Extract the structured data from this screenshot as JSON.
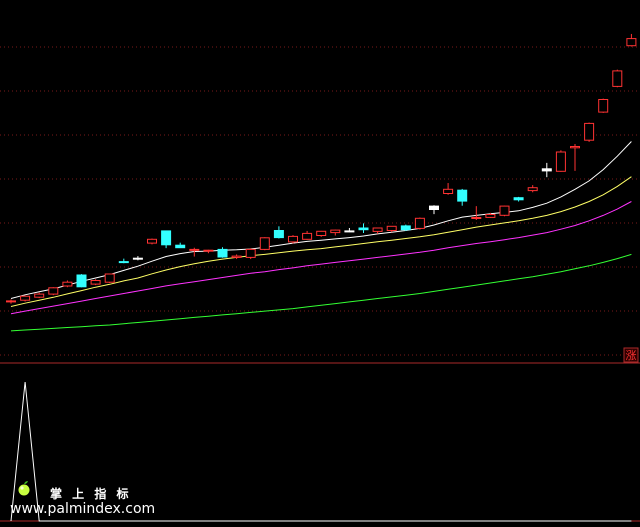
{
  "chart_data": {
    "type": "candlestick",
    "panels": [
      {
        "name": "price",
        "candles": [
          {
            "o": 61.0,
            "h": 62.2,
            "l": 60.2,
            "c": 61.5,
            "color": "red"
          },
          {
            "o": 61.8,
            "h": 64.0,
            "l": 61.2,
            "c": 63.7,
            "color": "red"
          },
          {
            "o": 63.2,
            "h": 65.4,
            "l": 62.8,
            "c": 64.7,
            "color": "red"
          },
          {
            "o": 64.7,
            "h": 68.0,
            "l": 64.2,
            "c": 67.7,
            "color": "red"
          },
          {
            "o": 68.6,
            "h": 71.2,
            "l": 68.0,
            "c": 70.4,
            "color": "red"
          },
          {
            "o": 73.8,
            "h": 74.2,
            "l": 68.0,
            "c": 68.2,
            "color": "cyan"
          },
          {
            "o": 69.5,
            "h": 71.8,
            "l": 69.0,
            "c": 71.2,
            "color": "red"
          },
          {
            "o": 70.4,
            "h": 74.5,
            "l": 70.0,
            "c": 74.3,
            "color": "red"
          },
          {
            "o": 80.2,
            "h": 81.6,
            "l": 79.4,
            "c": 79.8,
            "color": "cyan"
          },
          {
            "o": 81.8,
            "h": 82.8,
            "l": 80.8,
            "c": 81.5,
            "color": "white"
          },
          {
            "o": 89.0,
            "h": 91.2,
            "l": 88.4,
            "c": 90.8,
            "color": "red"
          },
          {
            "o": 94.8,
            "h": 95.0,
            "l": 86.6,
            "c": 88.2,
            "color": "cyan"
          },
          {
            "o": 88.0,
            "h": 89.2,
            "l": 86.8,
            "c": 86.8,
            "color": "cyan"
          },
          {
            "o": 85.6,
            "h": 86.8,
            "l": 82.6,
            "c": 86.0,
            "color": "red"
          },
          {
            "o": 85.2,
            "h": 85.8,
            "l": 84.2,
            "c": 85.6,
            "color": "red"
          },
          {
            "o": 86.0,
            "h": 87.0,
            "l": 82.0,
            "c": 82.4,
            "color": "cyan"
          },
          {
            "o": 82.2,
            "h": 83.6,
            "l": 81.4,
            "c": 82.8,
            "color": "red"
          },
          {
            "o": 82.2,
            "h": 86.6,
            "l": 81.4,
            "c": 86.0,
            "color": "red"
          },
          {
            "o": 86.0,
            "h": 91.8,
            "l": 85.6,
            "c": 91.5,
            "color": "red"
          },
          {
            "o": 95.0,
            "h": 97.0,
            "l": 91.2,
            "c": 91.6,
            "color": "cyan"
          },
          {
            "o": 89.6,
            "h": 92.8,
            "l": 88.8,
            "c": 92.2,
            "color": "red"
          },
          {
            "o": 90.8,
            "h": 94.8,
            "l": 90.6,
            "c": 93.6,
            "color": "red"
          },
          {
            "o": 92.6,
            "h": 94.8,
            "l": 92.0,
            "c": 94.6,
            "color": "red"
          },
          {
            "o": 94.0,
            "h": 95.4,
            "l": 92.6,
            "c": 95.2,
            "color": "red"
          },
          {
            "o": 94.6,
            "h": 96.2,
            "l": 94.2,
            "c": 94.8,
            "color": "white"
          },
          {
            "o": 95.4,
            "h": 98.4,
            "l": 93.8,
            "c": 96.2,
            "color": "cyan"
          },
          {
            "o": 94.6,
            "h": 96.2,
            "l": 93.4,
            "c": 96.2,
            "color": "red"
          },
          {
            "o": 95.0,
            "h": 97.0,
            "l": 94.2,
            "c": 97.0,
            "color": "red"
          },
          {
            "o": 97.2,
            "h": 97.8,
            "l": 94.8,
            "c": 95.4,
            "color": "cyan"
          },
          {
            "o": 96.0,
            "h": 101.2,
            "l": 95.4,
            "c": 100.8,
            "color": "red"
          },
          {
            "o": 106.6,
            "h": 107.0,
            "l": 102.8,
            "c": 105.0,
            "color": "white"
          },
          {
            "o": 112.6,
            "h": 117.6,
            "l": 112.0,
            "c": 114.6,
            "color": "red"
          },
          {
            "o": 114.2,
            "h": 114.8,
            "l": 106.8,
            "c": 109.0,
            "color": "cyan"
          },
          {
            "o": 100.8,
            "h": 106.6,
            "l": 100.0,
            "c": 101.2,
            "color": "red"
          },
          {
            "o": 101.2,
            "h": 103.4,
            "l": 101.0,
            "c": 102.6,
            "color": "red"
          },
          {
            "o": 102.2,
            "h": 106.8,
            "l": 101.8,
            "c": 106.6,
            "color": "red"
          },
          {
            "o": 110.6,
            "h": 111.0,
            "l": 108.8,
            "c": 109.6,
            "color": "cyan"
          },
          {
            "o": 114.0,
            "h": 116.6,
            "l": 113.2,
            "c": 115.4,
            "color": "red"
          },
          {
            "o": 123.4,
            "h": 127.2,
            "l": 120.4,
            "c": 124.4,
            "color": "white"
          },
          {
            "o": 123.2,
            "h": 133.2,
            "l": 123.0,
            "c": 132.4,
            "color": "red"
          },
          {
            "o": 134.4,
            "h": 136.2,
            "l": 123.4,
            "c": 135.0,
            "color": "red"
          },
          {
            "o": 138.0,
            "h": 146.4,
            "l": 137.2,
            "c": 146.0,
            "color": "red"
          },
          {
            "o": 151.4,
            "h": 157.8,
            "l": 151.0,
            "c": 157.4,
            "color": "red"
          },
          {
            "o": 163.6,
            "h": 171.6,
            "l": 163.2,
            "c": 171.0,
            "color": "red"
          },
          {
            "o": 183.0,
            "h": 188.6,
            "l": 182.6,
            "c": 186.4,
            "color": "red"
          }
        ],
        "lines": [
          {
            "color": "#ffffff",
            "values": [
              62.6,
              64.4,
              65.8,
              67.2,
              69.0,
              70.8,
              72.4,
              74.0,
              76.0,
              78.0,
              80.4,
              82.6,
              84.0,
              85.0,
              85.2,
              85.6,
              85.8,
              86.2,
              87.0,
              88.0,
              89.0,
              89.8,
              90.4,
              91.0,
              91.6,
              92.4,
              93.4,
              94.2,
              95.0,
              96.0,
              97.6,
              99.6,
              101.4,
              102.2,
              103.0,
              103.6,
              104.4,
              106.0,
              108.0,
              111.0,
              114.6,
              118.6,
              124.0,
              130.4,
              137.4
            ]
          },
          {
            "color": "#ffff66",
            "values": [
              58.8,
              60.4,
              61.8,
              63.2,
              64.8,
              66.4,
              68.0,
              69.4,
              71.0,
              72.4,
              74.4,
              76.2,
              77.8,
              79.2,
              80.4,
              81.4,
              82.2,
              83.0,
              83.6,
              84.4,
              85.2,
              85.8,
              86.4,
              87.2,
              88.0,
              88.8,
              89.6,
              90.4,
              91.2,
              92.0,
              93.0,
              94.2,
              95.4,
              96.6,
              97.6,
              98.6,
              99.6,
              100.8,
              102.2,
              104.0,
              106.2,
              108.8,
              112.0,
              116.0,
              120.6
            ]
          },
          {
            "color": "#ff33ff",
            "values": [
              55.4,
              56.6,
              57.8,
              59.0,
              60.2,
              61.4,
              62.6,
              63.8,
              65.0,
              66.2,
              67.4,
              68.6,
              69.6,
              70.6,
              71.6,
              72.6,
              73.6,
              74.6,
              75.4,
              76.4,
              77.2,
              78.2,
              79.0,
              79.8,
              80.6,
              81.4,
              82.2,
              83.0,
              83.8,
              84.6,
              85.6,
              86.8,
              87.8,
              88.8,
              89.6,
              90.6,
              91.6,
              92.8,
              94.0,
              95.6,
              97.4,
              99.6,
              102.2,
              105.2,
              108.8
            ]
          },
          {
            "color": "#33ff33",
            "values": [
              47.2,
              47.6,
              48.0,
              48.4,
              48.8,
              49.2,
              49.6,
              50.0,
              50.6,
              51.2,
              51.8,
              52.4,
              53.0,
              53.6,
              54.2,
              54.8,
              55.4,
              56.0,
              56.6,
              57.2,
              57.8,
              58.6,
              59.4,
              60.2,
              61.0,
              61.8,
              62.6,
              63.4,
              64.2,
              65.0,
              66.0,
              67.0,
              68.0,
              69.0,
              70.0,
              71.0,
              72.0,
              73.0,
              74.2,
              75.4,
              76.8,
              78.2,
              79.8,
              81.6,
              83.6
            ]
          }
        ],
        "grid": "dotted horizontal",
        "ylim": [
          40,
          200
        ]
      },
      {
        "name": "indicator",
        "series": [
          {
            "color": "#ffffff",
            "values": [
              0,
              1,
              0,
              0,
              0,
              0,
              0,
              0,
              0,
              0,
              0,
              0,
              0,
              0,
              0,
              0,
              0,
              0,
              0,
              0,
              0,
              0,
              0,
              0,
              0,
              0,
              0,
              0,
              0,
              0,
              0,
              0,
              0,
              0,
              0,
              0,
              0,
              0,
              0,
              0,
              0,
              0,
              0,
              0,
              0
            ]
          }
        ],
        "ylim": [
          0,
          1
        ]
      }
    ]
  },
  "badge": {
    "text": "涨"
  },
  "brand": {
    "name": "掌 上 指 标",
    "url": "www.palmindex.com",
    "logo_icon": "apple-icon"
  },
  "colors": {
    "up": "#ff3333",
    "down": "#33ffff",
    "flat": "#ffffff",
    "grid": "#7a1a1a",
    "divider": "#aa2a2a"
  }
}
